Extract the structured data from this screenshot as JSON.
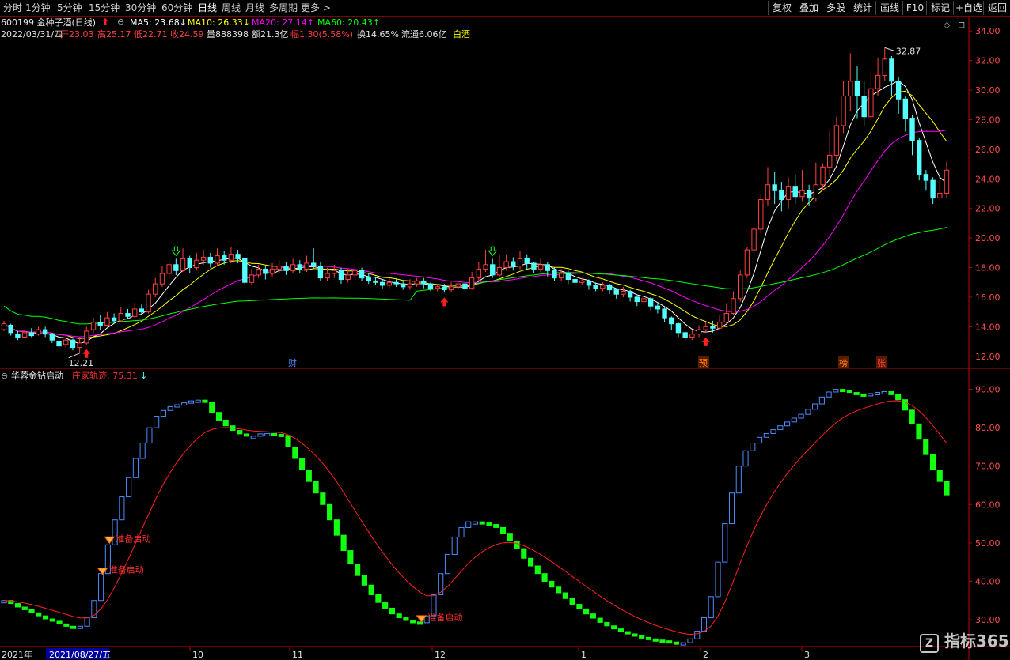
{
  "toolbar": {
    "periods": [
      "分时",
      "1分钟",
      "5分钟",
      "15分钟",
      "30分钟",
      "60分钟",
      "日线",
      "周线",
      "月线",
      "多周期",
      "更多 >"
    ],
    "active_period": "日线",
    "right_buttons": [
      "复权",
      "叠加",
      "多股",
      "统计",
      "画线",
      "F10",
      "标记",
      "+自选",
      "返回"
    ]
  },
  "stock": {
    "code_name": "600199 金种子酒(日线)",
    "ma5": "MA5: 23.68↓",
    "ma10": "MA10: 26.33↓",
    "ma20": "MA20: 27.14↑",
    "ma60": "MA60: 20.43↑",
    "date": "2022/03/31/四",
    "open": "开23.03",
    "high": "高25.17",
    "low": "低22.71",
    "close": "收24.59",
    "volume": "量888398",
    "amount": "额21.3亿",
    "change": "幅1.30(5.58%)",
    "turnover": "换14.65%",
    "float": "流通6.06亿",
    "sector": "白酒"
  },
  "colors": {
    "up": "#ff4040",
    "down": "#54ffff",
    "ma5": "#ffffff",
    "ma10": "#ffff00",
    "ma20": "#ff00ff",
    "ma60": "#00ff00",
    "axis": "#c00000",
    "trail": "#ff2020",
    "ind_up": "#4f8cff",
    "ind_down": "#12ff12"
  },
  "indicator": {
    "name": "华蓉金钻启动",
    "line_label": "庄家轨迹: 75.31",
    "arrow": "↓",
    "signal_text": "准备启动"
  },
  "markers": {
    "high_label": "32.87",
    "low_label": "12.21",
    "events": [
      "财",
      "预",
      "榜",
      "张"
    ]
  },
  "chart_data": {
    "type": "candlestick",
    "price_axis": {
      "ticks": [
        12,
        14,
        16,
        18,
        20,
        22,
        24,
        26,
        28,
        30,
        32,
        34
      ],
      "range": [
        11.4,
        34.6
      ]
    },
    "indicator_axis": {
      "ticks": [
        30,
        40,
        50,
        60,
        70,
        80,
        90
      ],
      "labels": [
        "30.00",
        "40.00",
        "50.00",
        "60.00",
        "70.00",
        "80.00",
        "90.00"
      ],
      "range": [
        23,
        93
      ]
    },
    "x_labels": [
      "2021年",
      "2021/08/27/五",
      "10",
      "11",
      "12",
      "1",
      "2",
      "3"
    ],
    "high": 32.87,
    "low": 12.21,
    "candles": [
      [
        13.8,
        14.2,
        14.4,
        13.7
      ],
      [
        14.1,
        13.6,
        14.2,
        13.4
      ],
      [
        13.5,
        13.3,
        13.7,
        13.1
      ],
      [
        13.3,
        13.6,
        13.8,
        13.2
      ],
      [
        13.6,
        13.4,
        13.9,
        13.3
      ],
      [
        13.5,
        13.8,
        14.0,
        13.4
      ],
      [
        13.8,
        13.5,
        14.0,
        13.3
      ],
      [
        13.5,
        13.1,
        13.6,
        12.9
      ],
      [
        13.0,
        12.7,
        13.2,
        12.5
      ],
      [
        12.8,
        13.1,
        13.4,
        12.6
      ],
      [
        13.1,
        12.6,
        13.2,
        12.4
      ],
      [
        12.6,
        12.9,
        13.3,
        12.2
      ],
      [
        12.9,
        13.7,
        14.0,
        12.8
      ],
      [
        13.8,
        14.3,
        14.6,
        13.6
      ],
      [
        14.3,
        14.1,
        14.8,
        13.8
      ],
      [
        14.1,
        14.6,
        15.0,
        14.0
      ],
      [
        14.6,
        14.4,
        14.9,
        14.2
      ],
      [
        14.4,
        14.9,
        15.3,
        14.3
      ],
      [
        14.9,
        14.7,
        15.2,
        14.5
      ],
      [
        14.7,
        15.2,
        15.6,
        14.6
      ],
      [
        15.2,
        15.0,
        15.5,
        14.8
      ],
      [
        15.0,
        16.2,
        16.5,
        14.9
      ],
      [
        16.2,
        16.9,
        17.3,
        16.0
      ],
      [
        16.9,
        17.6,
        18.1,
        16.7
      ],
      [
        17.6,
        18.2,
        18.5,
        17.3
      ],
      [
        18.2,
        17.8,
        18.6,
        17.5
      ],
      [
        17.8,
        18.6,
        19.3,
        17.7
      ],
      [
        18.6,
        18.0,
        18.8,
        17.6
      ],
      [
        18.0,
        18.5,
        19.0,
        17.8
      ],
      [
        18.5,
        18.7,
        19.2,
        18.2
      ],
      [
        18.7,
        18.3,
        19.0,
        18.0
      ],
      [
        18.3,
        18.8,
        19.3,
        18.1
      ],
      [
        18.8,
        18.5,
        19.1,
        18.2
      ],
      [
        18.5,
        18.9,
        19.4,
        18.3
      ],
      [
        18.9,
        18.6,
        19.2,
        18.3
      ],
      [
        18.6,
        17.0,
        18.7,
        16.9
      ],
      [
        17.0,
        17.5,
        17.9,
        16.8
      ],
      [
        17.5,
        17.9,
        18.2,
        17.3
      ],
      [
        17.9,
        17.6,
        18.1,
        17.2
      ],
      [
        17.6,
        17.9,
        18.3,
        17.4
      ],
      [
        17.9,
        18.1,
        18.5,
        17.6
      ],
      [
        18.1,
        17.8,
        18.4,
        17.5
      ],
      [
        17.8,
        18.2,
        18.6,
        17.6
      ],
      [
        18.2,
        17.9,
        18.5,
        17.6
      ],
      [
        17.9,
        18.3,
        18.8,
        17.7
      ],
      [
        18.3,
        18.1,
        19.3,
        17.9
      ],
      [
        18.1,
        17.3,
        18.4,
        17.1
      ],
      [
        17.3,
        17.6,
        18.0,
        17.1
      ],
      [
        17.6,
        17.8,
        18.2,
        17.3
      ],
      [
        17.8,
        17.2,
        18.0,
        16.9
      ],
      [
        17.2,
        17.5,
        17.9,
        17.0
      ],
      [
        17.5,
        17.8,
        18.3,
        17.3
      ],
      [
        17.8,
        17.3,
        18.0,
        17.1
      ],
      [
        17.3,
        17.1,
        17.6,
        16.9
      ],
      [
        17.1,
        17.0,
        17.4,
        16.8
      ],
      [
        17.0,
        16.8,
        17.2,
        16.6
      ],
      [
        16.8,
        17.0,
        17.3,
        16.6
      ],
      [
        17.0,
        16.9,
        17.2,
        16.7
      ],
      [
        16.9,
        16.7,
        17.1,
        16.5
      ],
      [
        16.7,
        16.9,
        17.2,
        16.5
      ],
      [
        16.9,
        17.1,
        17.3,
        16.7
      ],
      [
        17.1,
        16.9,
        17.3,
        16.6
      ],
      [
        16.9,
        16.6,
        17.0,
        16.4
      ],
      [
        16.6,
        16.7,
        16.9,
        16.4
      ],
      [
        16.7,
        16.5,
        16.9,
        16.3
      ],
      [
        16.5,
        16.7,
        17.0,
        16.3
      ],
      [
        16.7,
        16.9,
        17.1,
        16.5
      ],
      [
        16.9,
        16.6,
        17.1,
        16.4
      ],
      [
        16.6,
        17.3,
        17.7,
        16.5
      ],
      [
        17.3,
        17.9,
        18.4,
        17.1
      ],
      [
        17.9,
        18.2,
        19.2,
        17.7
      ],
      [
        18.2,
        17.5,
        18.6,
        17.3
      ],
      [
        17.5,
        18.0,
        18.9,
        17.4
      ],
      [
        18.0,
        18.4,
        18.9,
        17.8
      ],
      [
        18.4,
        18.1,
        18.7,
        17.8
      ],
      [
        18.1,
        18.6,
        19.1,
        17.9
      ],
      [
        18.6,
        18.3,
        18.9,
        17.9
      ],
      [
        18.3,
        17.9,
        18.4,
        17.6
      ],
      [
        17.9,
        18.2,
        18.6,
        17.7
      ],
      [
        18.2,
        17.8,
        18.4,
        17.4
      ],
      [
        17.8,
        17.3,
        18.0,
        17.1
      ],
      [
        17.3,
        17.6,
        17.9,
        17.1
      ],
      [
        17.6,
        17.2,
        17.8,
        16.9
      ],
      [
        17.2,
        17.0,
        17.4,
        16.8
      ],
      [
        17.0,
        17.1,
        17.3,
        16.8
      ],
      [
        17.1,
        16.8,
        17.2,
        16.5
      ],
      [
        16.8,
        16.6,
        17.0,
        16.4
      ],
      [
        16.6,
        16.8,
        17.0,
        16.4
      ],
      [
        16.8,
        16.5,
        16.9,
        16.2
      ],
      [
        16.5,
        16.2,
        16.6,
        15.9
      ],
      [
        16.2,
        16.4,
        16.7,
        16.0
      ],
      [
        16.4,
        16.0,
        16.5,
        15.7
      ],
      [
        16.0,
        15.7,
        16.1,
        15.4
      ],
      [
        15.7,
        15.9,
        16.1,
        15.4
      ],
      [
        15.9,
        15.4,
        16.0,
        15.1
      ],
      [
        15.4,
        15.2,
        15.6,
        14.9
      ],
      [
        15.2,
        14.6,
        15.3,
        14.3
      ],
      [
        14.6,
        14.2,
        14.7,
        13.8
      ],
      [
        14.2,
        13.6,
        14.3,
        13.3
      ],
      [
        13.6,
        13.3,
        13.7,
        13.0
      ],
      [
        13.3,
        13.5,
        13.8,
        13.1
      ],
      [
        13.5,
        13.8,
        14.1,
        13.3
      ],
      [
        13.8,
        14.0,
        14.3,
        13.6
      ],
      [
        14.0,
        13.9,
        14.4,
        13.6
      ],
      [
        13.9,
        14.3,
        14.8,
        13.8
      ],
      [
        14.3,
        14.9,
        15.6,
        14.2
      ],
      [
        14.9,
        15.9,
        16.4,
        14.8
      ],
      [
        15.9,
        17.5,
        17.8,
        15.7
      ],
      [
        17.5,
        19.2,
        19.4,
        17.3
      ],
      [
        19.2,
        20.6,
        21.0,
        19.0
      ],
      [
        20.6,
        22.6,
        23.0,
        20.3
      ],
      [
        22.6,
        23.6,
        24.8,
        22.2
      ],
      [
        23.6,
        23.2,
        24.5,
        22.3
      ],
      [
        23.2,
        22.6,
        23.8,
        21.8
      ],
      [
        22.6,
        23.5,
        24.1,
        22.0
      ],
      [
        23.5,
        22.8,
        24.3,
        22.3
      ],
      [
        22.8,
        23.2,
        24.6,
        22.5
      ],
      [
        23.2,
        22.7,
        23.6,
        22.2
      ],
      [
        22.7,
        23.6,
        25.1,
        22.5
      ],
      [
        23.6,
        24.8,
        25.0,
        23.2
      ],
      [
        24.8,
        25.6,
        27.3,
        24.1
      ],
      [
        25.6,
        27.6,
        28.2,
        25.2
      ],
      [
        27.6,
        29.6,
        30.6,
        27.1
      ],
      [
        29.6,
        30.6,
        32.5,
        28.6
      ],
      [
        30.6,
        29.6,
        31.6,
        28.1
      ],
      [
        29.6,
        28.2,
        30.6,
        27.6
      ],
      [
        28.2,
        30.1,
        31.3,
        27.9
      ],
      [
        30.1,
        31.0,
        32.2,
        29.6
      ],
      [
        31.0,
        32.1,
        32.87,
        30.6
      ],
      [
        32.1,
        30.6,
        32.3,
        29.6
      ],
      [
        30.6,
        29.4,
        30.9,
        28.4
      ],
      [
        29.4,
        28.1,
        29.6,
        27.2
      ],
      [
        28.1,
        26.6,
        28.3,
        25.6
      ],
      [
        26.6,
        24.3,
        26.8,
        23.9
      ],
      [
        24.3,
        23.9,
        24.6,
        23.2
      ],
      [
        23.9,
        22.7,
        24.1,
        22.3
      ],
      [
        22.71,
        23.03,
        24.5,
        22.6
      ],
      [
        23.03,
        24.59,
        25.17,
        22.71
      ]
    ],
    "ma_periods": [
      5,
      10,
      20,
      60
    ],
    "indicator_series": [
      35.0,
      34.2,
      33.3,
      32.6,
      31.8,
      31.0,
      30.2,
      29.6,
      28.9,
      28.3,
      27.9,
      28.3,
      30.5,
      35.0,
      42.0,
      49.5,
      56.0,
      62.0,
      67.0,
      72.0,
      76.0,
      80.0,
      83.0,
      84.5,
      85.5,
      86.0,
      86.5,
      87.0,
      87.2,
      86.6,
      84.0,
      82.0,
      80.5,
      79.3,
      78.4,
      77.8,
      77.8,
      78.4,
      78.5,
      78.3,
      78.0,
      75.0,
      72.0,
      69.0,
      66.0,
      63.0,
      60.0,
      56.0,
      52.0,
      48.0,
      44.5,
      41.5,
      39.0,
      36.5,
      34.5,
      33.0,
      31.5,
      30.5,
      29.8,
      29.4,
      29.2,
      31.0,
      36.5,
      42.0,
      47.0,
      51.5,
      54.0,
      55.5,
      55.5,
      55.2,
      54.8,
      54.0,
      52.5,
      50.5,
      48.5,
      46.0,
      44.0,
      42.0,
      40.0,
      38.5,
      37.0,
      35.5,
      34.0,
      32.8,
      31.5,
      30.4,
      29.3,
      28.4,
      27.6,
      26.9,
      26.3,
      25.8,
      25.4,
      25.0,
      24.7,
      24.5,
      24.2,
      24.0,
      24.0,
      25.0,
      27.0,
      30.5,
      36.0,
      45.0,
      55.0,
      63.0,
      70.0,
      74.0,
      76.0,
      77.5,
      78.5,
      79.5,
      80.5,
      81.5,
      82.5,
      83.5,
      84.8,
      86.2,
      88.0,
      89.3,
      90.0,
      89.8,
      89.2,
      88.8,
      88.6,
      88.9,
      89.2,
      89.4,
      88.6,
      87.3,
      84.6,
      81.0,
      77.0,
      73.0,
      69.0,
      66.0,
      62.5
    ],
    "trail_period": 12
  }
}
